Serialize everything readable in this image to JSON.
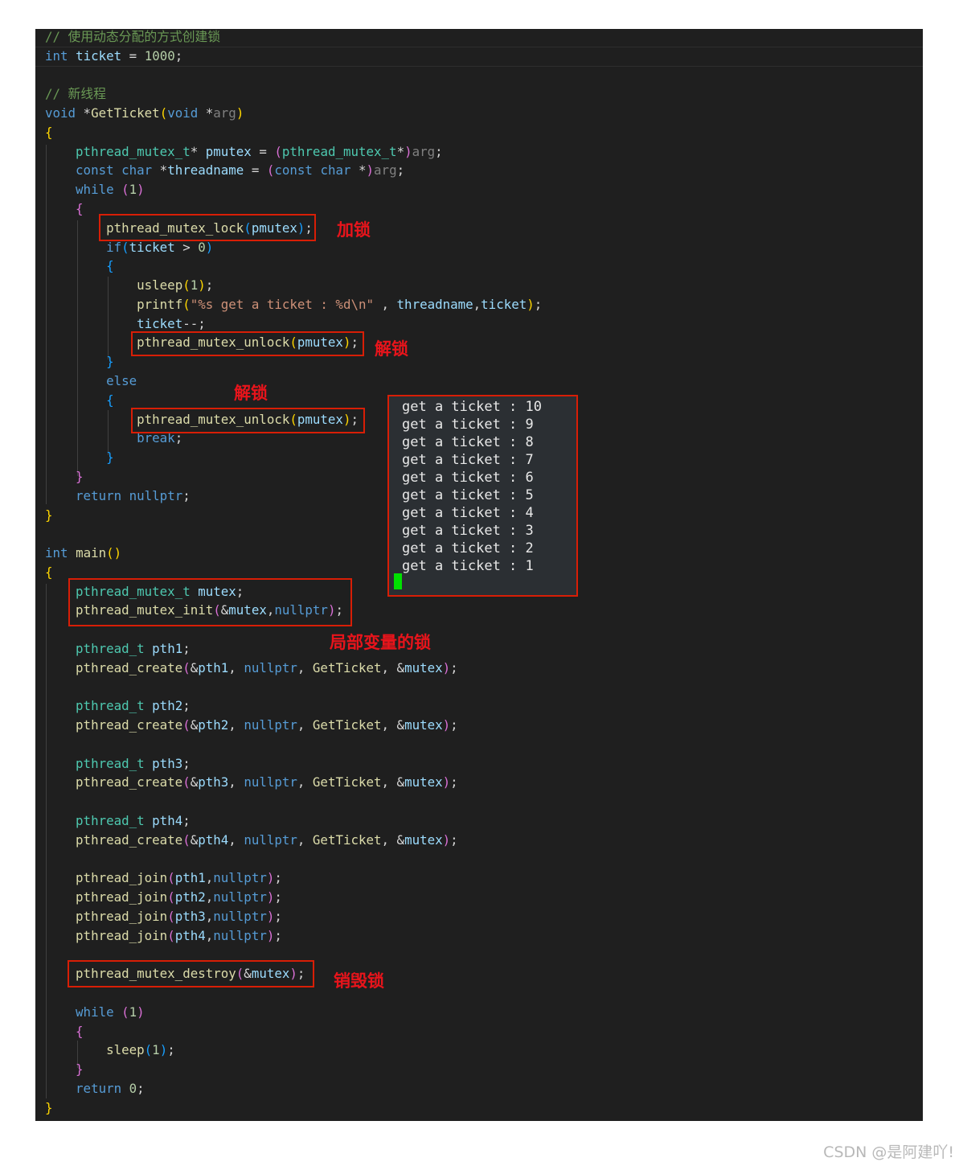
{
  "editor": {
    "lines": [
      [
        {
          "t": "// 使用动态分配的方式创建锁",
          "c": "cm"
        }
      ],
      [
        {
          "t": "int",
          "c": "kw"
        },
        {
          "t": " ",
          "c": "op"
        },
        {
          "t": "ticket",
          "c": "id"
        },
        {
          "t": " = ",
          "c": "op"
        },
        {
          "t": "1000",
          "c": "nu"
        },
        {
          "t": ";",
          "c": "op"
        }
      ],
      [],
      [
        {
          "t": "// 新线程",
          "c": "cm"
        }
      ],
      [
        {
          "t": "void",
          "c": "kw"
        },
        {
          "t": " *",
          "c": "op"
        },
        {
          "t": "GetTicket",
          "c": "fn"
        },
        {
          "t": "(",
          "c": "b1"
        },
        {
          "t": "void",
          "c": "kw"
        },
        {
          "t": " *",
          "c": "op"
        },
        {
          "t": "arg",
          "c": "pm"
        },
        {
          "t": ")",
          "c": "b1"
        }
      ],
      [
        {
          "t": "{",
          "c": "b1"
        }
      ],
      [
        {
          "t": "    ",
          "c": "op"
        },
        {
          "t": "pthread_mutex_t",
          "c": "ty"
        },
        {
          "t": "* ",
          "c": "op"
        },
        {
          "t": "pmutex",
          "c": "id"
        },
        {
          "t": " = ",
          "c": "op"
        },
        {
          "t": "(",
          "c": "b2"
        },
        {
          "t": "pthread_mutex_t",
          "c": "ty"
        },
        {
          "t": "*",
          "c": "op"
        },
        {
          "t": ")",
          "c": "b2"
        },
        {
          "t": "arg",
          "c": "pm"
        },
        {
          "t": ";",
          "c": "op"
        }
      ],
      [
        {
          "t": "    ",
          "c": "op"
        },
        {
          "t": "const",
          "c": "kw"
        },
        {
          "t": " ",
          "c": "op"
        },
        {
          "t": "char",
          "c": "kw"
        },
        {
          "t": " *",
          "c": "op"
        },
        {
          "t": "threadname",
          "c": "id"
        },
        {
          "t": " = ",
          "c": "op"
        },
        {
          "t": "(",
          "c": "b2"
        },
        {
          "t": "const",
          "c": "kw"
        },
        {
          "t": " ",
          "c": "op"
        },
        {
          "t": "char",
          "c": "kw"
        },
        {
          "t": " *",
          "c": "op"
        },
        {
          "t": ")",
          "c": "b2"
        },
        {
          "t": "arg",
          "c": "pm"
        },
        {
          "t": ";",
          "c": "op"
        }
      ],
      [
        {
          "t": "    ",
          "c": "op"
        },
        {
          "t": "while",
          "c": "kw"
        },
        {
          "t": " ",
          "c": "op"
        },
        {
          "t": "(",
          "c": "b2"
        },
        {
          "t": "1",
          "c": "nu"
        },
        {
          "t": ")",
          "c": "b2"
        }
      ],
      [
        {
          "t": "    ",
          "c": "op"
        },
        {
          "t": "{",
          "c": "b2"
        }
      ],
      [
        {
          "t": "        ",
          "c": "op"
        },
        {
          "t": "pthread_mutex_lock",
          "c": "fn"
        },
        {
          "t": "(",
          "c": "b3"
        },
        {
          "t": "pmutex",
          "c": "id"
        },
        {
          "t": ")",
          "c": "b3"
        },
        {
          "t": ";",
          "c": "op"
        }
      ],
      [
        {
          "t": "        ",
          "c": "op"
        },
        {
          "t": "if",
          "c": "kw"
        },
        {
          "t": "(",
          "c": "b3"
        },
        {
          "t": "ticket",
          "c": "id"
        },
        {
          "t": " > ",
          "c": "op"
        },
        {
          "t": "0",
          "c": "nu"
        },
        {
          "t": ")",
          "c": "b3"
        }
      ],
      [
        {
          "t": "        ",
          "c": "op"
        },
        {
          "t": "{",
          "c": "b3"
        }
      ],
      [
        {
          "t": "            ",
          "c": "op"
        },
        {
          "t": "usleep",
          "c": "fn"
        },
        {
          "t": "(",
          "c": "b1"
        },
        {
          "t": "1",
          "c": "nu"
        },
        {
          "t": ")",
          "c": "b1"
        },
        {
          "t": ";",
          "c": "op"
        }
      ],
      [
        {
          "t": "            ",
          "c": "op"
        },
        {
          "t": "printf",
          "c": "fn"
        },
        {
          "t": "(",
          "c": "b1"
        },
        {
          "t": "\"%s get a ticket : %d\\n\"",
          "c": "st"
        },
        {
          "t": " , ",
          "c": "op"
        },
        {
          "t": "threadname",
          "c": "id"
        },
        {
          "t": ",",
          "c": "op"
        },
        {
          "t": "ticket",
          "c": "id"
        },
        {
          "t": ")",
          "c": "b1"
        },
        {
          "t": ";",
          "c": "op"
        }
      ],
      [
        {
          "t": "            ",
          "c": "op"
        },
        {
          "t": "ticket",
          "c": "id"
        },
        {
          "t": "--;",
          "c": "op"
        }
      ],
      [
        {
          "t": "            ",
          "c": "op"
        },
        {
          "t": "pthread_mutex_unlock",
          "c": "fn"
        },
        {
          "t": "(",
          "c": "b1"
        },
        {
          "t": "pmutex",
          "c": "id"
        },
        {
          "t": ")",
          "c": "b1"
        },
        {
          "t": ";",
          "c": "op"
        }
      ],
      [
        {
          "t": "        ",
          "c": "op"
        },
        {
          "t": "}",
          "c": "b3"
        }
      ],
      [
        {
          "t": "        ",
          "c": "op"
        },
        {
          "t": "else",
          "c": "kw"
        }
      ],
      [
        {
          "t": "        ",
          "c": "op"
        },
        {
          "t": "{",
          "c": "b3"
        }
      ],
      [
        {
          "t": "            ",
          "c": "op"
        },
        {
          "t": "pthread_mutex_unlock",
          "c": "fn"
        },
        {
          "t": "(",
          "c": "b1"
        },
        {
          "t": "pmutex",
          "c": "id"
        },
        {
          "t": ")",
          "c": "b1"
        },
        {
          "t": ";",
          "c": "op"
        }
      ],
      [
        {
          "t": "            ",
          "c": "op"
        },
        {
          "t": "break",
          "c": "kw"
        },
        {
          "t": ";",
          "c": "op"
        }
      ],
      [
        {
          "t": "        ",
          "c": "op"
        },
        {
          "t": "}",
          "c": "b3"
        }
      ],
      [
        {
          "t": "    ",
          "c": "op"
        },
        {
          "t": "}",
          "c": "b2"
        }
      ],
      [
        {
          "t": "    ",
          "c": "op"
        },
        {
          "t": "return",
          "c": "kw"
        },
        {
          "t": " ",
          "c": "op"
        },
        {
          "t": "nullptr",
          "c": "kw"
        },
        {
          "t": ";",
          "c": "op"
        }
      ],
      [
        {
          "t": "}",
          "c": "b1"
        }
      ],
      [],
      [
        {
          "t": "int",
          "c": "kw"
        },
        {
          "t": " ",
          "c": "op"
        },
        {
          "t": "main",
          "c": "fn"
        },
        {
          "t": "()",
          "c": "b1"
        }
      ],
      [
        {
          "t": "{",
          "c": "b1"
        }
      ],
      [
        {
          "t": "    ",
          "c": "op"
        },
        {
          "t": "pthread_mutex_t",
          "c": "ty"
        },
        {
          "t": " ",
          "c": "op"
        },
        {
          "t": "mutex",
          "c": "id"
        },
        {
          "t": ";",
          "c": "op"
        }
      ],
      [
        {
          "t": "    ",
          "c": "op"
        },
        {
          "t": "pthread_mutex_init",
          "c": "fn"
        },
        {
          "t": "(",
          "c": "b2"
        },
        {
          "t": "&",
          "c": "op"
        },
        {
          "t": "mutex",
          "c": "id"
        },
        {
          "t": ",",
          "c": "op"
        },
        {
          "t": "nullptr",
          "c": "kw"
        },
        {
          "t": ")",
          "c": "b2"
        },
        {
          "t": ";",
          "c": "op"
        }
      ],
      [],
      [
        {
          "t": "    ",
          "c": "op"
        },
        {
          "t": "pthread_t",
          "c": "ty"
        },
        {
          "t": " ",
          "c": "op"
        },
        {
          "t": "pth1",
          "c": "id"
        },
        {
          "t": ";",
          "c": "op"
        }
      ],
      [
        {
          "t": "    ",
          "c": "op"
        },
        {
          "t": "pthread_create",
          "c": "fn"
        },
        {
          "t": "(",
          "c": "b2"
        },
        {
          "t": "&",
          "c": "op"
        },
        {
          "t": "pth1",
          "c": "id"
        },
        {
          "t": ", ",
          "c": "op"
        },
        {
          "t": "nullptr",
          "c": "kw"
        },
        {
          "t": ", ",
          "c": "op"
        },
        {
          "t": "GetTicket",
          "c": "fn"
        },
        {
          "t": ", &",
          "c": "op"
        },
        {
          "t": "mutex",
          "c": "id"
        },
        {
          "t": ")",
          "c": "b2"
        },
        {
          "t": ";",
          "c": "op"
        }
      ],
      [],
      [
        {
          "t": "    ",
          "c": "op"
        },
        {
          "t": "pthread_t",
          "c": "ty"
        },
        {
          "t": " ",
          "c": "op"
        },
        {
          "t": "pth2",
          "c": "id"
        },
        {
          "t": ";",
          "c": "op"
        }
      ],
      [
        {
          "t": "    ",
          "c": "op"
        },
        {
          "t": "pthread_create",
          "c": "fn"
        },
        {
          "t": "(",
          "c": "b2"
        },
        {
          "t": "&",
          "c": "op"
        },
        {
          "t": "pth2",
          "c": "id"
        },
        {
          "t": ", ",
          "c": "op"
        },
        {
          "t": "nullptr",
          "c": "kw"
        },
        {
          "t": ", ",
          "c": "op"
        },
        {
          "t": "GetTicket",
          "c": "fn"
        },
        {
          "t": ", &",
          "c": "op"
        },
        {
          "t": "mutex",
          "c": "id"
        },
        {
          "t": ")",
          "c": "b2"
        },
        {
          "t": ";",
          "c": "op"
        }
      ],
      [],
      [
        {
          "t": "    ",
          "c": "op"
        },
        {
          "t": "pthread_t",
          "c": "ty"
        },
        {
          "t": " ",
          "c": "op"
        },
        {
          "t": "pth3",
          "c": "id"
        },
        {
          "t": ";",
          "c": "op"
        }
      ],
      [
        {
          "t": "    ",
          "c": "op"
        },
        {
          "t": "pthread_create",
          "c": "fn"
        },
        {
          "t": "(",
          "c": "b2"
        },
        {
          "t": "&",
          "c": "op"
        },
        {
          "t": "pth3",
          "c": "id"
        },
        {
          "t": ", ",
          "c": "op"
        },
        {
          "t": "nullptr",
          "c": "kw"
        },
        {
          "t": ", ",
          "c": "op"
        },
        {
          "t": "GetTicket",
          "c": "fn"
        },
        {
          "t": ", &",
          "c": "op"
        },
        {
          "t": "mutex",
          "c": "id"
        },
        {
          "t": ")",
          "c": "b2"
        },
        {
          "t": ";",
          "c": "op"
        }
      ],
      [],
      [
        {
          "t": "    ",
          "c": "op"
        },
        {
          "t": "pthread_t",
          "c": "ty"
        },
        {
          "t": " ",
          "c": "op"
        },
        {
          "t": "pth4",
          "c": "id"
        },
        {
          "t": ";",
          "c": "op"
        }
      ],
      [
        {
          "t": "    ",
          "c": "op"
        },
        {
          "t": "pthread_create",
          "c": "fn"
        },
        {
          "t": "(",
          "c": "b2"
        },
        {
          "t": "&",
          "c": "op"
        },
        {
          "t": "pth4",
          "c": "id"
        },
        {
          "t": ", ",
          "c": "op"
        },
        {
          "t": "nullptr",
          "c": "kw"
        },
        {
          "t": ", ",
          "c": "op"
        },
        {
          "t": "GetTicket",
          "c": "fn"
        },
        {
          "t": ", &",
          "c": "op"
        },
        {
          "t": "mutex",
          "c": "id"
        },
        {
          "t": ")",
          "c": "b2"
        },
        {
          "t": ";",
          "c": "op"
        }
      ],
      [],
      [
        {
          "t": "    ",
          "c": "op"
        },
        {
          "t": "pthread_join",
          "c": "fn"
        },
        {
          "t": "(",
          "c": "b2"
        },
        {
          "t": "pth1",
          "c": "id"
        },
        {
          "t": ",",
          "c": "op"
        },
        {
          "t": "nullptr",
          "c": "kw"
        },
        {
          "t": ")",
          "c": "b2"
        },
        {
          "t": ";",
          "c": "op"
        }
      ],
      [
        {
          "t": "    ",
          "c": "op"
        },
        {
          "t": "pthread_join",
          "c": "fn"
        },
        {
          "t": "(",
          "c": "b2"
        },
        {
          "t": "pth2",
          "c": "id"
        },
        {
          "t": ",",
          "c": "op"
        },
        {
          "t": "nullptr",
          "c": "kw"
        },
        {
          "t": ")",
          "c": "b2"
        },
        {
          "t": ";",
          "c": "op"
        }
      ],
      [
        {
          "t": "    ",
          "c": "op"
        },
        {
          "t": "pthread_join",
          "c": "fn"
        },
        {
          "t": "(",
          "c": "b2"
        },
        {
          "t": "pth3",
          "c": "id"
        },
        {
          "t": ",",
          "c": "op"
        },
        {
          "t": "nullptr",
          "c": "kw"
        },
        {
          "t": ")",
          "c": "b2"
        },
        {
          "t": ";",
          "c": "op"
        }
      ],
      [
        {
          "t": "    ",
          "c": "op"
        },
        {
          "t": "pthread_join",
          "c": "fn"
        },
        {
          "t": "(",
          "c": "b2"
        },
        {
          "t": "pth4",
          "c": "id"
        },
        {
          "t": ",",
          "c": "op"
        },
        {
          "t": "nullptr",
          "c": "kw"
        },
        {
          "t": ")",
          "c": "b2"
        },
        {
          "t": ";",
          "c": "op"
        }
      ],
      [],
      [
        {
          "t": "    ",
          "c": "op"
        },
        {
          "t": "pthread_mutex_destroy",
          "c": "fn"
        },
        {
          "t": "(",
          "c": "b2"
        },
        {
          "t": "&",
          "c": "op"
        },
        {
          "t": "mutex",
          "c": "id"
        },
        {
          "t": ")",
          "c": "b2"
        },
        {
          "t": ";",
          "c": "op"
        }
      ],
      [],
      [
        {
          "t": "    ",
          "c": "op"
        },
        {
          "t": "while",
          "c": "kw"
        },
        {
          "t": " ",
          "c": "op"
        },
        {
          "t": "(",
          "c": "b2"
        },
        {
          "t": "1",
          "c": "nu"
        },
        {
          "t": ")",
          "c": "b2"
        }
      ],
      [
        {
          "t": "    ",
          "c": "op"
        },
        {
          "t": "{",
          "c": "b2"
        }
      ],
      [
        {
          "t": "        ",
          "c": "op"
        },
        {
          "t": "sleep",
          "c": "fn"
        },
        {
          "t": "(",
          "c": "b3"
        },
        {
          "t": "1",
          "c": "nu"
        },
        {
          "t": ")",
          "c": "b3"
        },
        {
          "t": ";",
          "c": "op"
        }
      ],
      [
        {
          "t": "    ",
          "c": "op"
        },
        {
          "t": "}",
          "c": "b2"
        }
      ],
      [
        {
          "t": "    ",
          "c": "op"
        },
        {
          "t": "return",
          "c": "kw"
        },
        {
          "t": " ",
          "c": "op"
        },
        {
          "t": "0",
          "c": "nu"
        },
        {
          "t": ";",
          "c": "op"
        }
      ],
      [
        {
          "t": "}",
          "c": "b1"
        }
      ]
    ]
  },
  "annotations": {
    "lock": "加锁",
    "unlock_1": "解锁",
    "unlock_2": "解锁",
    "local_lock": "局部变量的锁",
    "destroy_lock": "销毁锁"
  },
  "terminal": {
    "lines": [
      "get a ticket : 10",
      "get a ticket : 9",
      "get a ticket : 8",
      "get a ticket : 7",
      "get a ticket : 6",
      "get a ticket : 5",
      "get a ticket : 4",
      "get a ticket : 3",
      "get a ticket : 2",
      "get a ticket : 1"
    ]
  },
  "watermark": "CSDN @是阿建吖!"
}
